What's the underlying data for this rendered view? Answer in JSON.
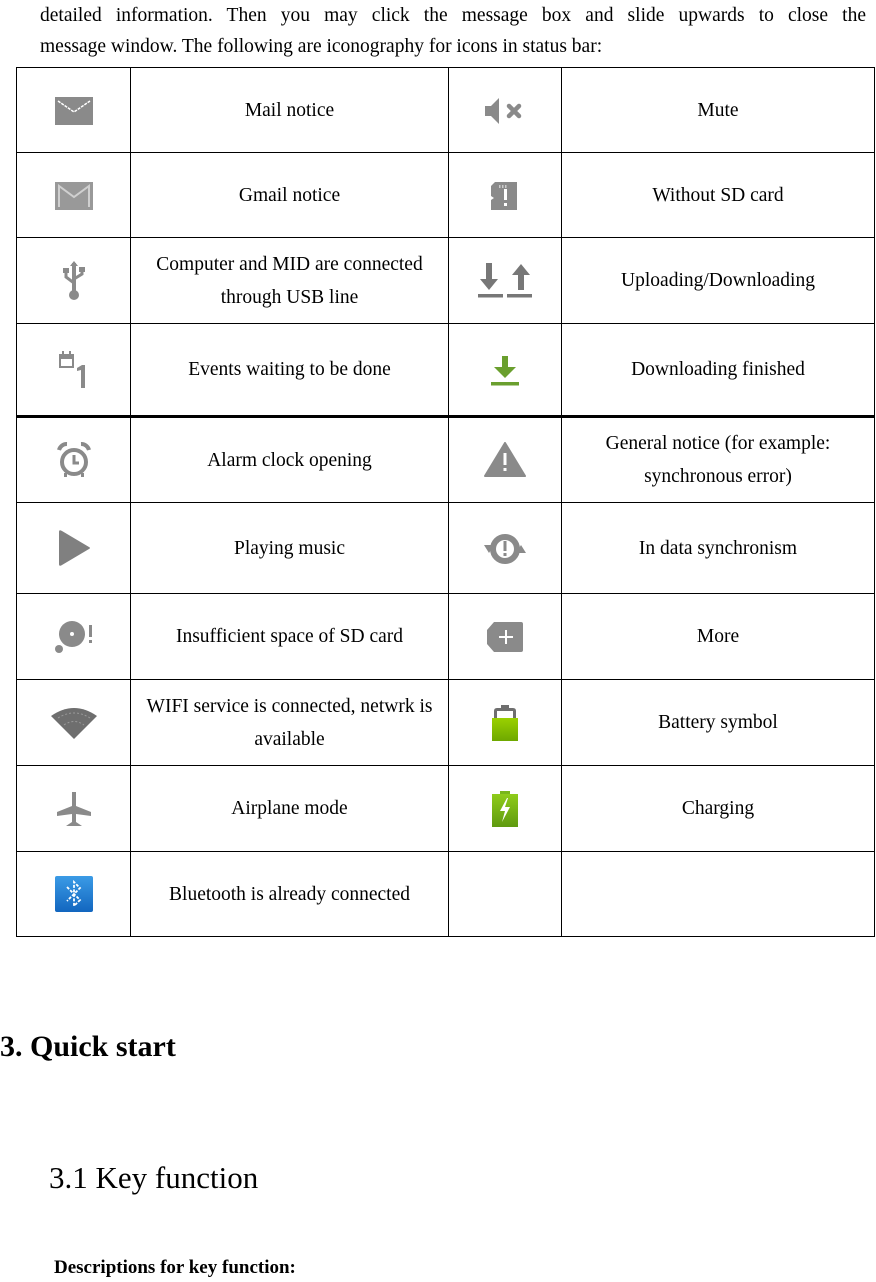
{
  "intro": {
    "line1": "detailed information. Then you may click the message box and slide upwards to close the",
    "line2": "message window. The following are iconography for icons in status bar:"
  },
  "icon_table": {
    "rows": [
      {
        "left": {
          "icon": "mail-icon",
          "label": "Mail notice"
        },
        "right": {
          "icon": "mute-icon",
          "label": "Mute"
        }
      },
      {
        "left": {
          "icon": "gmail-icon",
          "label": "Gmail notice"
        },
        "right": {
          "icon": "no-sd-card-icon",
          "label": "Without SD card"
        }
      },
      {
        "left": {
          "icon": "usb-icon",
          "label": "Computer and MID are connected through USB line"
        },
        "right": {
          "icon": "upload-download-icon",
          "label": "Uploading/Downloading"
        }
      },
      {
        "left": {
          "icon": "calendar-event-icon",
          "label": "Events waiting to be done"
        },
        "right": {
          "icon": "download-done-icon",
          "label": "Downloading finished"
        }
      },
      {
        "left": {
          "icon": "alarm-clock-icon",
          "label": "Alarm clock opening"
        },
        "right": {
          "icon": "warning-icon",
          "label": "General notice (for example: synchronous error)"
        }
      },
      {
        "left": {
          "icon": "play-icon",
          "label": "Playing music"
        },
        "right": {
          "icon": "sync-icon",
          "label": "In data synchronism"
        }
      },
      {
        "left": {
          "icon": "sd-card-full-icon",
          "label": "Insufficient space of SD card"
        },
        "right": {
          "icon": "more-icon",
          "label": "More"
        }
      },
      {
        "left": {
          "icon": "wifi-icon",
          "label": "WIFI service is connected, netwrk is available"
        },
        "right": {
          "icon": "battery-icon",
          "label": "Battery symbol"
        }
      },
      {
        "left": {
          "icon": "airplane-icon",
          "label": "Airplane mode"
        },
        "right": {
          "icon": "charging-icon",
          "label": "Charging"
        }
      },
      {
        "left": {
          "icon": "bluetooth-icon",
          "label": "Bluetooth is already connected"
        },
        "right": {
          "icon": "",
          "label": ""
        }
      }
    ]
  },
  "colors": {
    "icon_gray": "#8a8a8a",
    "download_green": "#6a9f2e",
    "battery_green": "#86c400",
    "bluetooth_blue": "#1e7fd4"
  },
  "sections": {
    "heading": "3. Quick start",
    "subheading": "3.1 Key function",
    "descriptions_label": "Descriptions for key function:"
  }
}
